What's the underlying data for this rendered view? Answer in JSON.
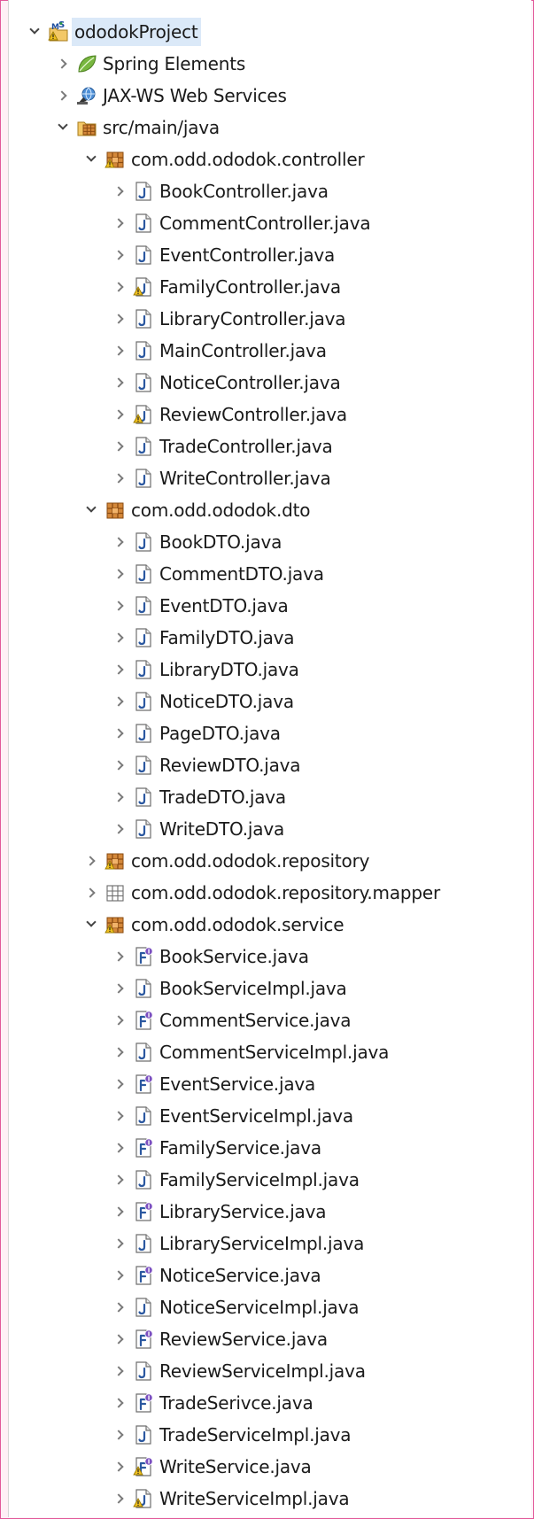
{
  "window": {
    "panel": "package-explorer"
  },
  "colors": {
    "frame_border": "#e2589a",
    "selection": "#dbe9f8",
    "package_brown": "#b5651d",
    "class_blue": "#2b58a0",
    "interface_purple": "#6b3fa0",
    "warning_yellow": "#f0c020"
  },
  "tree": {
    "project": {
      "label": "ododokProject",
      "icon": "maven-project-icon",
      "expanded": true,
      "selected": true
    },
    "spring": {
      "label": "Spring Elements",
      "icon": "spring-leaf-icon"
    },
    "jaxws": {
      "label": "JAX-WS Web Services",
      "icon": "web-services-icon"
    },
    "src": {
      "label": "src/main/java",
      "icon": "source-folder-icon",
      "expanded": true
    },
    "pkg_controller": {
      "label": "com.odd.ododok.controller",
      "icon": "package-warning-icon",
      "files": [
        {
          "label": "BookController.java",
          "icon": "java-class-icon",
          "warning": false
        },
        {
          "label": "CommentController.java",
          "icon": "java-class-icon",
          "warning": false
        },
        {
          "label": "EventController.java",
          "icon": "java-class-icon",
          "warning": false
        },
        {
          "label": "FamilyController.java",
          "icon": "java-class-icon",
          "warning": true
        },
        {
          "label": "LibraryController.java",
          "icon": "java-class-icon",
          "warning": false
        },
        {
          "label": "MainController.java",
          "icon": "java-class-icon",
          "warning": false
        },
        {
          "label": "NoticeController.java",
          "icon": "java-class-icon",
          "warning": false
        },
        {
          "label": "ReviewController.java",
          "icon": "java-class-icon",
          "warning": true
        },
        {
          "label": "TradeController.java",
          "icon": "java-class-icon",
          "warning": false
        },
        {
          "label": "WriteController.java",
          "icon": "java-class-icon",
          "warning": false
        }
      ]
    },
    "pkg_dto": {
      "label": "com.odd.ododok.dto",
      "icon": "package-icon",
      "files": [
        {
          "label": "BookDTO.java",
          "icon": "java-class-icon",
          "warning": false
        },
        {
          "label": "CommentDTO.java",
          "icon": "java-class-icon",
          "warning": false
        },
        {
          "label": "EventDTO.java",
          "icon": "java-class-icon",
          "warning": false
        },
        {
          "label": "FamilyDTO.java",
          "icon": "java-class-icon",
          "warning": false
        },
        {
          "label": "LibraryDTO.java",
          "icon": "java-class-icon",
          "warning": false
        },
        {
          "label": "NoticeDTO.java",
          "icon": "java-class-icon",
          "warning": false
        },
        {
          "label": "PageDTO.java",
          "icon": "java-class-icon",
          "warning": false
        },
        {
          "label": "ReviewDTO.java",
          "icon": "java-class-icon",
          "warning": false
        },
        {
          "label": "TradeDTO.java",
          "icon": "java-class-icon",
          "warning": false
        },
        {
          "label": "WriteDTO.java",
          "icon": "java-class-icon",
          "warning": false
        }
      ]
    },
    "pkg_repository": {
      "label": "com.odd.ododok.repository",
      "icon": "package-warning-icon"
    },
    "pkg_mapper": {
      "label": "com.odd.ododok.repository.mapper",
      "icon": "empty-package-icon"
    },
    "pkg_service": {
      "label": "com.odd.ododok.service",
      "icon": "package-warning-icon",
      "files": [
        {
          "label": "BookService.java",
          "icon": "java-interface-icon",
          "warning": false
        },
        {
          "label": "BookServiceImpl.java",
          "icon": "java-class-icon",
          "warning": false
        },
        {
          "label": "CommentService.java",
          "icon": "java-interface-icon",
          "warning": false
        },
        {
          "label": "CommentServiceImpl.java",
          "icon": "java-class-icon",
          "warning": false
        },
        {
          "label": "EventService.java",
          "icon": "java-interface-icon",
          "warning": false
        },
        {
          "label": "EventServiceImpl.java",
          "icon": "java-class-icon",
          "warning": false
        },
        {
          "label": "FamilyService.java",
          "icon": "java-interface-icon",
          "warning": false
        },
        {
          "label": "FamilyServiceImpl.java",
          "icon": "java-class-icon",
          "warning": false
        },
        {
          "label": "LibraryService.java",
          "icon": "java-interface-icon",
          "warning": false
        },
        {
          "label": "LibraryServiceImpl.java",
          "icon": "java-class-icon",
          "warning": false
        },
        {
          "label": "NoticeService.java",
          "icon": "java-interface-icon",
          "warning": false
        },
        {
          "label": "NoticeServiceImpl.java",
          "icon": "java-class-icon",
          "warning": false
        },
        {
          "label": "ReviewService.java",
          "icon": "java-interface-icon",
          "warning": false
        },
        {
          "label": "ReviewServiceImpl.java",
          "icon": "java-class-icon",
          "warning": false
        },
        {
          "label": "TradeSerivce.java",
          "icon": "java-interface-icon",
          "warning": false
        },
        {
          "label": "TradeServiceImpl.java",
          "icon": "java-class-icon",
          "warning": false
        },
        {
          "label": "WriteService.java",
          "icon": "java-interface-icon",
          "warning": true
        },
        {
          "label": "WriteServiceImpl.java",
          "icon": "java-class-icon",
          "warning": true
        }
      ]
    }
  }
}
